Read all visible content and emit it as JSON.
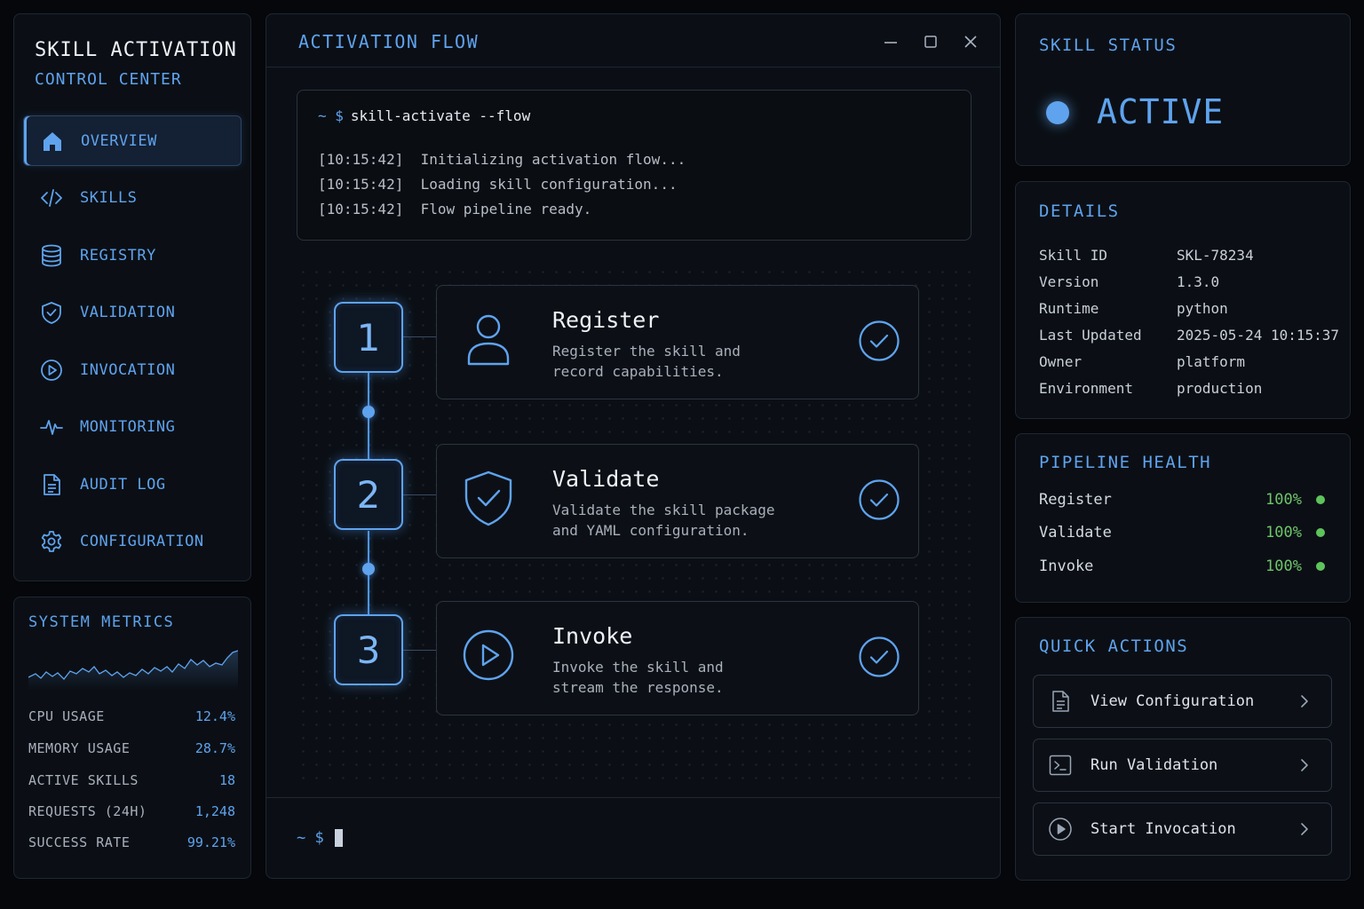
{
  "brand": {
    "title": "SKILL ACTIVATION",
    "subtitle": "CONTROL CENTER"
  },
  "nav": {
    "items": [
      {
        "label": "OVERVIEW",
        "icon": "home-icon",
        "active": true
      },
      {
        "label": "SKILLS",
        "icon": "code-icon"
      },
      {
        "label": "REGISTRY",
        "icon": "database-icon"
      },
      {
        "label": "VALIDATION",
        "icon": "shield-check-icon"
      },
      {
        "label": "INVOCATION",
        "icon": "play-circle-icon"
      },
      {
        "label": "MONITORING",
        "icon": "pulse-icon"
      },
      {
        "label": "AUDIT LOG",
        "icon": "document-icon"
      },
      {
        "label": "CONFIGURATION",
        "icon": "gear-icon"
      }
    ]
  },
  "metrics": {
    "title": "SYSTEM METRICS",
    "rows": [
      {
        "label": "CPU USAGE",
        "value": "12.4%"
      },
      {
        "label": "MEMORY USAGE",
        "value": "28.7%"
      },
      {
        "label": "ACTIVE SKILLS",
        "value": "18"
      },
      {
        "label": "REQUESTS (24H)",
        "value": "1,248"
      },
      {
        "label": "SUCCESS RATE",
        "value": "99.21%"
      }
    ]
  },
  "flow": {
    "title": "ACTIVATION FLOW",
    "terminal": {
      "prompt": "~ $",
      "command": "skill-activate --flow",
      "logs": [
        {
          "time": "[10:15:42]",
          "message": "Initializing activation flow..."
        },
        {
          "time": "[10:15:42]",
          "message": "Loading skill configuration..."
        },
        {
          "time": "[10:15:42]",
          "message": "Flow pipeline ready."
        }
      ]
    },
    "steps": [
      {
        "number": "1",
        "title": "Register",
        "desc1": "Register the skill and",
        "desc2": "record capabilities.",
        "icon": "user-icon"
      },
      {
        "number": "2",
        "title": "Validate",
        "desc1": "Validate the skill package",
        "desc2": "and YAML configuration.",
        "icon": "shield-check-icon"
      },
      {
        "number": "3",
        "title": "Invoke",
        "desc1": "Invoke the skill and",
        "desc2": "stream the response.",
        "icon": "play-circle-icon"
      }
    ],
    "prompt": "~ $"
  },
  "status": {
    "title": "SKILL STATUS",
    "value": "ACTIVE",
    "color": "#5fa3ee"
  },
  "details": {
    "title": "DETAILS",
    "rows": [
      {
        "label": "Skill ID",
        "value": "SKL-78234"
      },
      {
        "label": "Version",
        "value": "1.3.0"
      },
      {
        "label": "Runtime",
        "value": "python"
      },
      {
        "label": "Last Updated",
        "value": "2025-05-24 10:15:37"
      },
      {
        "label": "Owner",
        "value": "platform"
      },
      {
        "label": "Environment",
        "value": "production"
      }
    ]
  },
  "health": {
    "title": "PIPELINE HEALTH",
    "rows": [
      {
        "label": "Register",
        "value": "100%"
      },
      {
        "label": "Validate",
        "value": "100%"
      },
      {
        "label": "Invoke",
        "value": "100%"
      }
    ],
    "ok_color": "#5fc35c"
  },
  "actions": {
    "title": "QUICK ACTIONS",
    "items": [
      {
        "label": "View Configuration",
        "icon": "document-icon"
      },
      {
        "label": "Run Validation",
        "icon": "terminal-icon"
      },
      {
        "label": "Start Invocation",
        "icon": "play-circle-icon"
      }
    ]
  },
  "colors": {
    "accent": "#5fa3ee",
    "background": "#05070b",
    "panel": "#0b0f15",
    "success": "#6fc46a"
  }
}
